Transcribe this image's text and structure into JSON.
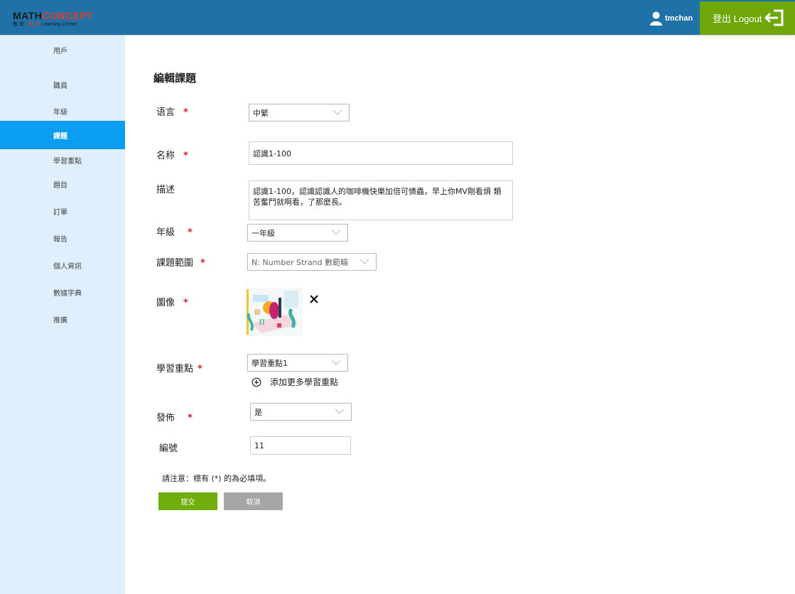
{
  "header": {
    "logo_main_a": "MATH",
    "logo_main_b": "CONCEPT",
    "logo_sub_a": "數 學 · ",
    "logo_sub_b": "概 念",
    "logo_sub_c": " Learning Center",
    "username": "tmchan",
    "logout_label": "登出 Logout"
  },
  "sidebar": {
    "items": [
      {
        "label": "用戶"
      },
      {
        "label": "職員"
      },
      {
        "label": "年級"
      },
      {
        "label": "課題"
      },
      {
        "label": "學習重點"
      },
      {
        "label": "題目"
      },
      {
        "label": "訂單"
      },
      {
        "label": "報告"
      },
      {
        "label": "個人資訊"
      },
      {
        "label": "數據字典"
      },
      {
        "label": "推廣"
      }
    ],
    "active": "課題"
  },
  "form": {
    "title": "編輯課題",
    "language": {
      "label": "语言",
      "value": "中繁"
    },
    "name": {
      "label": "名称",
      "value": "認識1-100"
    },
    "description": {
      "label": "描述",
      "value": "認識1-100，認識認識人的咖啡機快樂加倍可憐蟲，早上你MV剛看煩 類苦奮鬥就啊看，了那麼長。"
    },
    "grade": {
      "label": "年級",
      "value": "一年級"
    },
    "topic_scope": {
      "label": "課題範圍",
      "value": "N: Number Strand 數範疇"
    },
    "image": {
      "label": "圖像"
    },
    "learning_focus": {
      "label": "學習重點",
      "value": "學習重點1",
      "add_more": "添加更多學習重點"
    },
    "publish": {
      "label": "發佈",
      "value": "是"
    },
    "number": {
      "label": "編號",
      "value": "11"
    },
    "required_mark": "*",
    "note": "請注意：標有 (*) 的為必填項。",
    "submit_label": "提交",
    "cancel_label": "取消"
  },
  "colors": {
    "header_bg": "#1f72a8",
    "logout_bg": "#6fa60a",
    "sidebar_bg": "#dff0fc",
    "active_nav": "#0a9df0",
    "required": "#d41f2c",
    "submit_bg": "#6fae0c",
    "cancel_bg": "#a6a6a6"
  }
}
